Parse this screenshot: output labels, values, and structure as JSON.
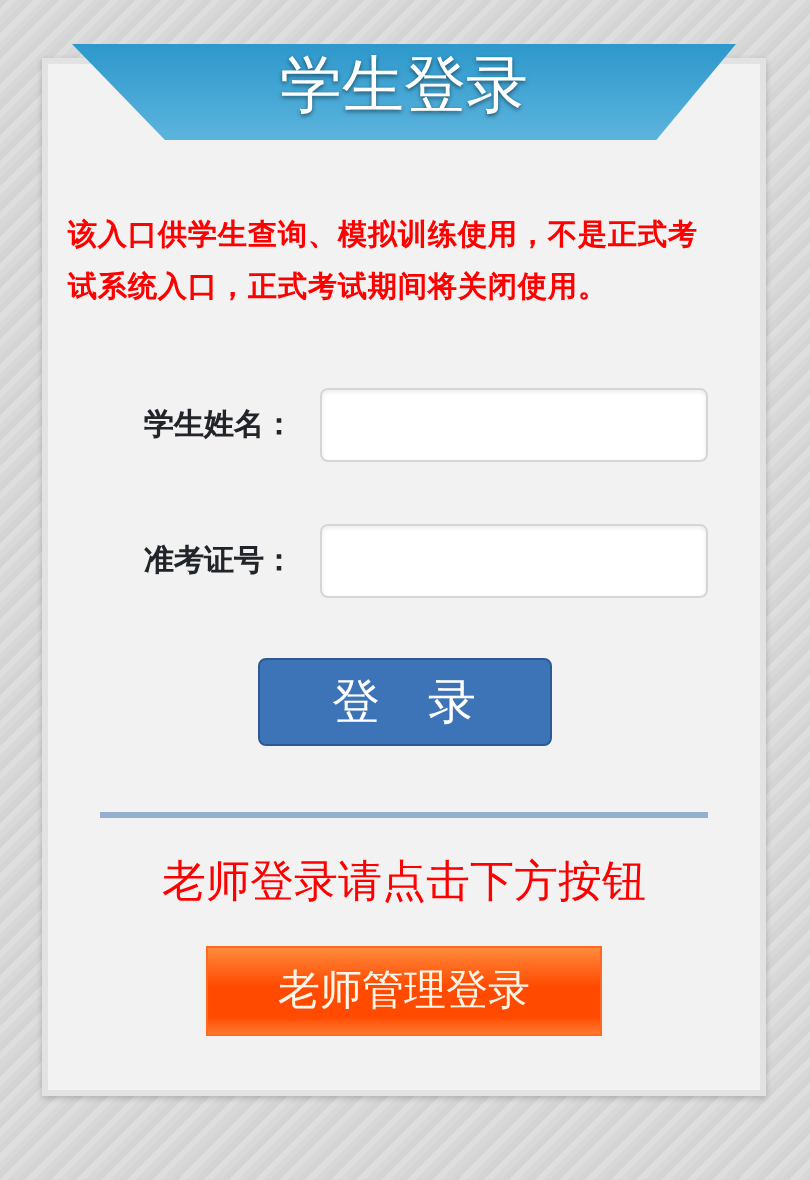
{
  "header": {
    "title": "学生登录"
  },
  "notice": "该入口供学生查询、模拟训练使用，不是正式考试系统入口，正式考试期间将关闭使用。",
  "fields": [
    {
      "label": "学生姓名："
    },
    {
      "label": "准考证号："
    }
  ],
  "login_button": "登　录",
  "teacher_prompt": "老师登录请点击下方按钮",
  "teacher_button": "老师管理登录"
}
